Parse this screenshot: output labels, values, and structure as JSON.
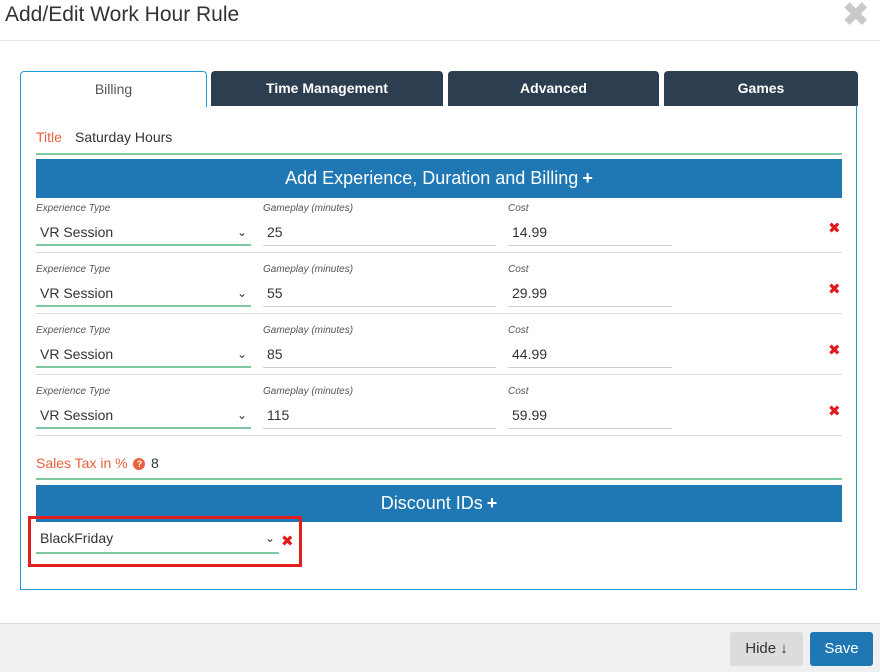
{
  "dialog": {
    "title": "Add/Edit Work Hour Rule",
    "close_glyph": "✖"
  },
  "tabs": [
    {
      "label": "Billing",
      "active": true
    },
    {
      "label": "Time Management",
      "active": false
    },
    {
      "label": "Advanced",
      "active": false
    },
    {
      "label": "Games",
      "active": false
    }
  ],
  "billing": {
    "title_label": "Title",
    "title_value": "Saturday Hours",
    "experience_bar_label": "Add Experience, Duration and Billing",
    "plus_glyph": "+",
    "column_labels": {
      "experience_type": "Experience Type",
      "gameplay": "Gameplay (minutes)",
      "cost": "Cost"
    },
    "rows": [
      {
        "experience_type": "VR Session",
        "gameplay": "25",
        "cost": "14.99"
      },
      {
        "experience_type": "VR Session",
        "gameplay": "55",
        "cost": "29.99"
      },
      {
        "experience_type": "VR Session",
        "gameplay": "85",
        "cost": "44.99"
      },
      {
        "experience_type": "VR Session",
        "gameplay": "115",
        "cost": "59.99"
      }
    ],
    "sales_tax_label": "Sales Tax in %",
    "help_glyph": "?",
    "sales_tax_value": "8",
    "discount_bar_label": "Discount IDs",
    "discounts": [
      {
        "value": "BlackFriday"
      }
    ]
  },
  "footer": {
    "hide_label": "Hide ↓",
    "save_label": "Save"
  },
  "icons": {
    "delete": "delete-x-icon",
    "chevron": "chevron-down-icon",
    "close": "close-icon",
    "help": "help-circle-icon"
  },
  "colors": {
    "accent": "#1f78b4",
    "tab_dark": "#2c3e4f",
    "label_orange": "#e8603c",
    "underline_green": "#7ec9a1",
    "delete_red": "#e01a1a",
    "highlight_red": "#e41f1f"
  }
}
